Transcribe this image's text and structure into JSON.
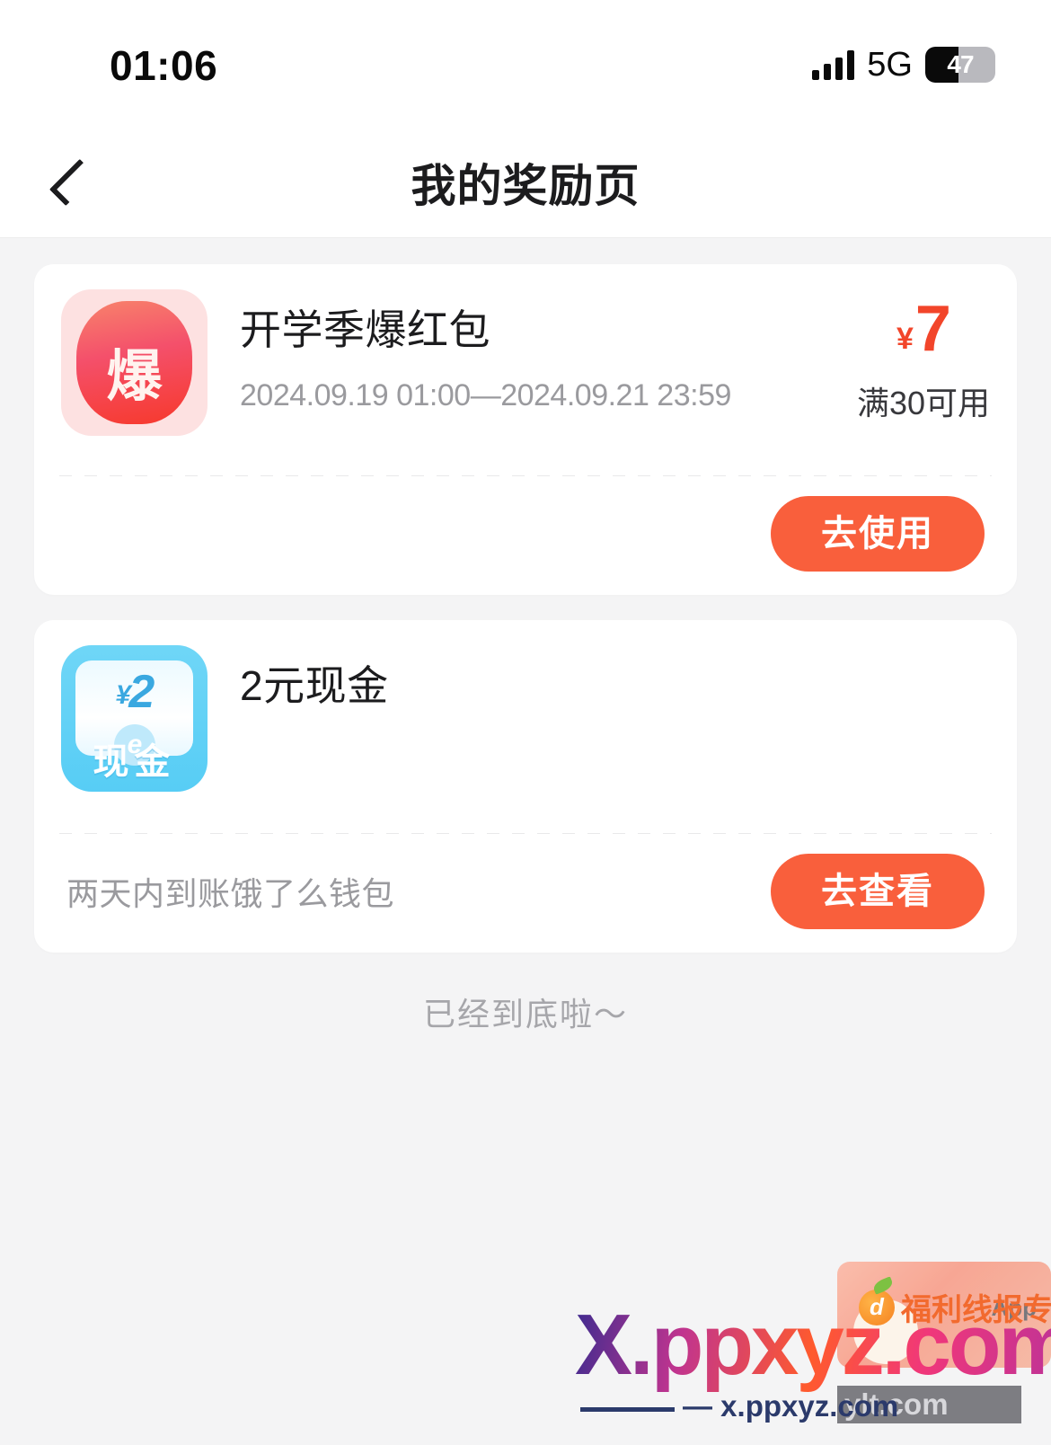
{
  "status_bar": {
    "time": "01:06",
    "network": "5G",
    "battery_level": "47",
    "signal_icon": "signal-bars-icon",
    "battery_icon": "battery-icon"
  },
  "header": {
    "title": "我的奖励页",
    "back_icon": "back-chevron-icon"
  },
  "rewards": [
    {
      "icon_name": "bao-red-packet-icon",
      "icon_glyph": "爆",
      "title": "开学季爆红包",
      "validity": "2024.09.19 01:00—2024.09.21 23:59",
      "currency_symbol": "¥",
      "amount": "7",
      "condition": "满30可用",
      "note": "",
      "cta_label": "去使用"
    },
    {
      "icon_name": "cash-coupon-icon",
      "icon_amount_symbol": "¥",
      "icon_amount": "2",
      "icon_brand_glyph": "e",
      "icon_label": "现金",
      "title": "2元现金",
      "validity": "",
      "currency_symbol": "",
      "amount": "",
      "condition": "",
      "note": "两天内到账饿了么钱包",
      "cta_label": "去查看"
    }
  ],
  "list_end_text": "已经到底啦～",
  "watermark": {
    "main": "X.ppxyz.com",
    "sub": "— x.ppxyz.com",
    "overlay": "ylt.com",
    "badge_label": "福利线报专家",
    "badge_app": "App",
    "fruit_icon": "orange-fruit-icon"
  },
  "colors": {
    "page_background": "#f4f4f5",
    "card_background": "#ffffff",
    "accent_cta": "#f95f3c",
    "price_red": "#f2452a",
    "muted_text": "#9a9a9e",
    "primary_text": "#1c1c1e",
    "cash_icon_blue": "#57cdf5"
  }
}
